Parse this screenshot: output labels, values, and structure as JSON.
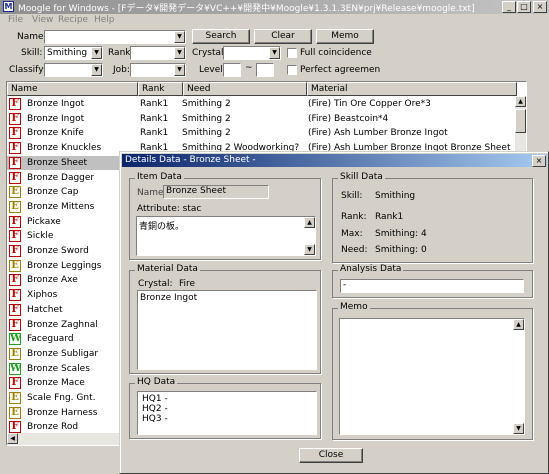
{
  "window": {
    "title": "Moogle for Windows - [Fデータ¥開発データ¥VC++¥開発中¥Moogle¥1.3.1.3EN¥prj¥Release¥moogle.txt]",
    "icon": "M",
    "min_glyph": "_",
    "max_glyph": "□",
    "close_glyph": "×"
  },
  "menu": {
    "file": "File",
    "view": "View",
    "recipe": "Recipe",
    "help": "Help"
  },
  "search": {
    "name_label": "Name:",
    "name_value": "",
    "search_button": "Search",
    "clear_button": "Clear",
    "memo_button": "Memo",
    "skill_label": "Skill:",
    "skill_value": "Smithing",
    "rank_label": "Rank:",
    "rank_value": "",
    "crystal_label": "Crystal:",
    "crystal_value": "",
    "full_coincidence": "Full coincidence",
    "classify_label": "Classify:",
    "classify_value": "",
    "job_label": "Job:",
    "job_value": "",
    "level_label": "Level:",
    "level_sep": "~",
    "level_from": "",
    "level_to": "",
    "perfect_agreement": "Perfect agreemen"
  },
  "list": {
    "columns": {
      "name": "Name",
      "rank": "Rank",
      "need": "Need",
      "material": "Material"
    },
    "rows": [
      {
        "type": "F",
        "name": "Bronze Ingot",
        "rank": "Rank1",
        "need": "Smithing  2",
        "material": "(Fire) Tin Ore  Copper Ore*3"
      },
      {
        "type": "F",
        "name": "Bronze Ingot",
        "rank": "Rank1",
        "need": "Smithing  2",
        "material": "(Fire) Beastcoin*4"
      },
      {
        "type": "F",
        "name": "Bronze Knife",
        "rank": "Rank1",
        "need": "Smithing  2",
        "material": "(Fire) Ash Lumber  Bronze Ingot"
      },
      {
        "type": "F",
        "name": "Bronze Knuckles",
        "rank": "Rank1",
        "need": "Smithing  2 Woodworking?",
        "material": "(Fire) Ash Lumber  Bronze Ingot  Bronze Sheet"
      },
      {
        "type": "F",
        "name": "Bronze Sheet",
        "rank": "",
        "need": "",
        "material": ""
      },
      {
        "type": "F",
        "name": "Bronze Dagger",
        "rank": "",
        "need": "",
        "material": ""
      },
      {
        "type": "E",
        "name": "Bronze Cap",
        "rank": "",
        "need": "",
        "material": ""
      },
      {
        "type": "E",
        "name": "Bronze Mittens",
        "rank": "",
        "need": "",
        "material": ""
      },
      {
        "type": "F",
        "name": "Pickaxe",
        "rank": "",
        "need": "",
        "material": ""
      },
      {
        "type": "F",
        "name": "Sickle",
        "rank": "",
        "need": "",
        "material": ""
      },
      {
        "type": "F",
        "name": "Bronze Sword",
        "rank": "",
        "need": "",
        "material": ""
      },
      {
        "type": "E",
        "name": "Bronze Leggings",
        "rank": "",
        "need": "",
        "material": ""
      },
      {
        "type": "F",
        "name": "Bronze Axe",
        "rank": "",
        "need": "",
        "material": ""
      },
      {
        "type": "F",
        "name": "Xiphos",
        "rank": "",
        "need": "",
        "material": ""
      },
      {
        "type": "F",
        "name": "Hatchet",
        "rank": "",
        "need": "",
        "material": ""
      },
      {
        "type": "F",
        "name": "Bronze Zaghnal",
        "rank": "",
        "need": "",
        "material": ""
      },
      {
        "type": "W",
        "name": "Faceguard",
        "rank": "",
        "need": "",
        "material": ""
      },
      {
        "type": "E",
        "name": "Bronze Subligar",
        "rank": "",
        "need": "",
        "material": ""
      },
      {
        "type": "W",
        "name": "Bronze Scales",
        "rank": "",
        "need": "",
        "material": ""
      },
      {
        "type": "F",
        "name": "Bronze Mace",
        "rank": "",
        "need": "",
        "material": ""
      },
      {
        "type": "E",
        "name": "Scale Fng. Gnt.",
        "rank": "",
        "need": "",
        "material": ""
      },
      {
        "type": "E",
        "name": "Bronze Harness",
        "rank": "",
        "need": "",
        "material": ""
      },
      {
        "type": "F",
        "name": "Bronze Rod",
        "rank": "",
        "need": "",
        "material": ""
      }
    ]
  },
  "details": {
    "title": "Details Data - Bronze Sheet -",
    "close_glyph": "×",
    "item_data": "Item Data",
    "name_label": "Name:",
    "name_value": "Bronze Sheet",
    "attribute": "Attribute:  stac",
    "description": "青銅の板。",
    "skill_data": "Skill Data",
    "skill_label": "Skill:",
    "skill_value": "Smithing",
    "rank_label": "Rank:",
    "rank_value": "Rank1",
    "max_label": "Max:",
    "max_value": "Smithing:  4",
    "need_label": "Need:",
    "need_value": "Smithing:  0",
    "material_data": "Material Data",
    "crystal_label": "Crystal:",
    "crystal_value": "Fire",
    "material_value": "Bronze Ingot",
    "analysis_data": "Analysis Data",
    "analysis_value": "-",
    "memo": "Memo",
    "hq_data": "HQ Data",
    "hq1": "HQ1   -",
    "hq2": "HQ2   -",
    "hq3": "HQ3   -",
    "close_button": "Close"
  },
  "colors": {
    "F": "#c00000",
    "E": "#a08000",
    "W": "#20a020"
  }
}
